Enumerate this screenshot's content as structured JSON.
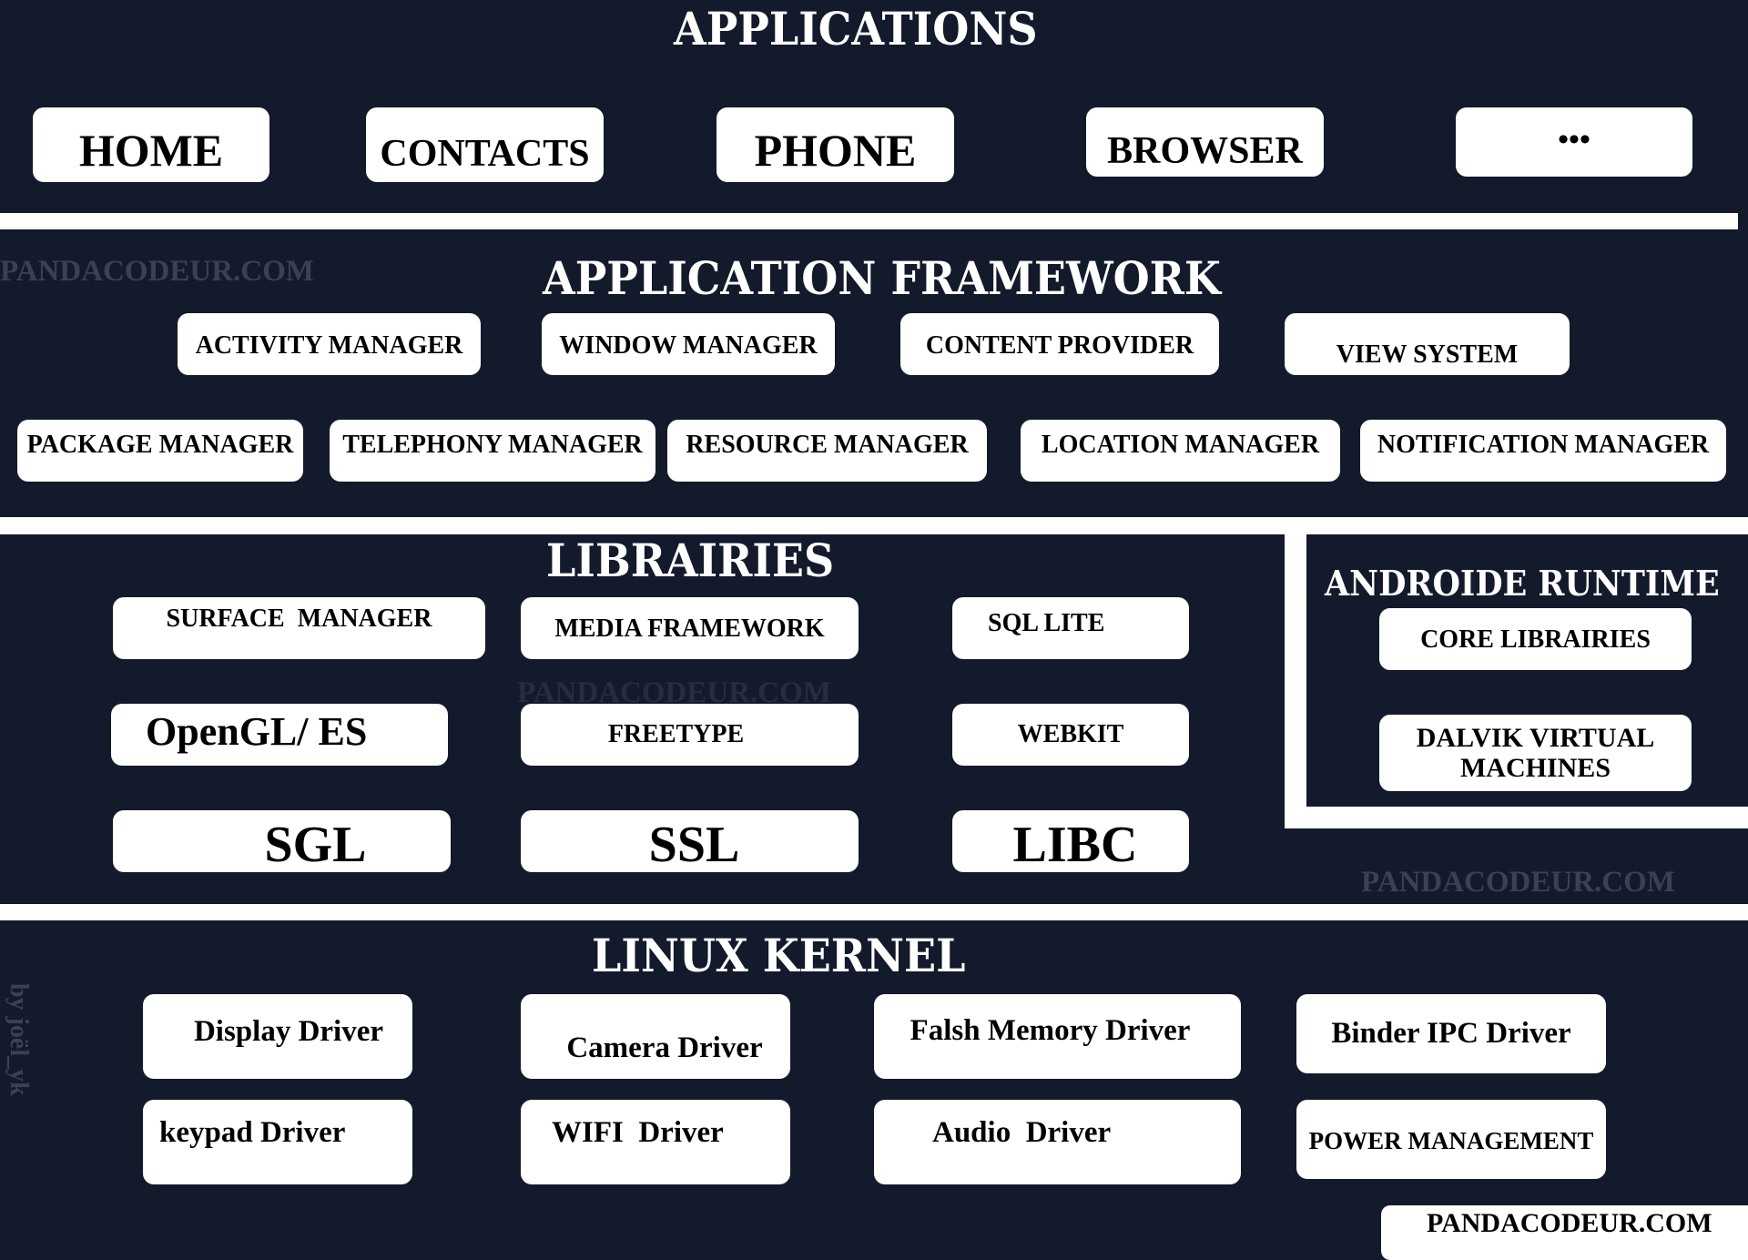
{
  "layers": {
    "applications": {
      "title": "APPLICATIONS",
      "items": [
        "HOME",
        "CONTACTS",
        "PHONE",
        "BROWSER",
        "•••"
      ]
    },
    "framework": {
      "title": "APPLICATION FRAMEWORK",
      "row1": [
        "ACTIVITY MANAGER",
        "WINDOW MANAGER",
        "CONTENT PROVIDER",
        "VIEW SYSTEM"
      ],
      "row2": [
        "PACKAGE MANAGER",
        "TELEPHONY MANAGER",
        "RESOURCE MANAGER",
        "LOCATION MANAGER",
        "NOTIFICATION MANAGER"
      ]
    },
    "libraries": {
      "title": "LIBRAIRIES",
      "items": [
        "SURFACE  MANAGER",
        "MEDIA FRAMEWORK",
        "SQL LITE",
        "OpenGL/ ES",
        "FREETYPE",
        "WEBKIT",
        "SGL",
        "SSL",
        "LIBC"
      ]
    },
    "runtime": {
      "title": "ANDROIDE RUNTIME",
      "items": [
        "CORE LIBRAIRIES",
        "DALVIK VIRTUAL",
        "MACHINES"
      ]
    },
    "kernel": {
      "title": "LINUX KERNEL",
      "items": [
        "Display Driver",
        "Camera Driver",
        "Falsh Memory Driver",
        "Binder IPC Driver",
        "keypad Driver",
        "WIFI  Driver",
        "Audio  Driver",
        "POWER MANAGEMENT"
      ]
    }
  },
  "watermarks": {
    "site": "PANDACODEUR.COM",
    "author": "by joël_yk"
  },
  "colors": {
    "background": "#131a2c",
    "box": "#ffffff",
    "watermark": "#3a4156"
  }
}
